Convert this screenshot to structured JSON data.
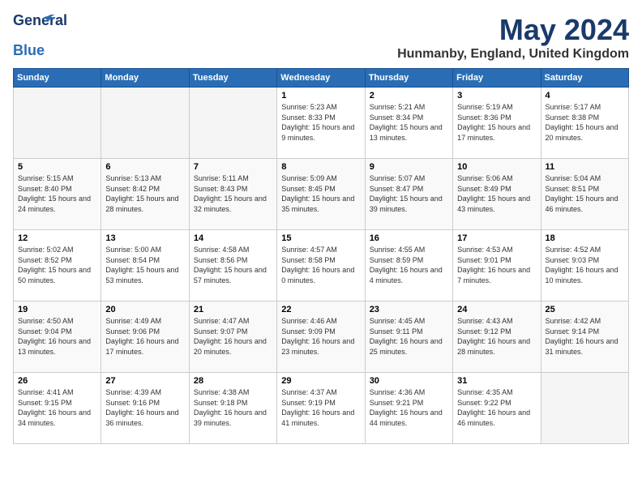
{
  "header": {
    "logo_line1": "General",
    "logo_line2": "Blue",
    "month": "May 2024",
    "location": "Hunmanby, England, United Kingdom"
  },
  "weekdays": [
    "Sunday",
    "Monday",
    "Tuesday",
    "Wednesday",
    "Thursday",
    "Friday",
    "Saturday"
  ],
  "weeks": [
    [
      {
        "day": "",
        "empty": true
      },
      {
        "day": "",
        "empty": true
      },
      {
        "day": "",
        "empty": true
      },
      {
        "day": "1",
        "sunrise": "5:23 AM",
        "sunset": "8:33 PM",
        "daylight": "15 hours and 9 minutes."
      },
      {
        "day": "2",
        "sunrise": "5:21 AM",
        "sunset": "8:34 PM",
        "daylight": "15 hours and 13 minutes."
      },
      {
        "day": "3",
        "sunrise": "5:19 AM",
        "sunset": "8:36 PM",
        "daylight": "15 hours and 17 minutes."
      },
      {
        "day": "4",
        "sunrise": "5:17 AM",
        "sunset": "8:38 PM",
        "daylight": "15 hours and 20 minutes."
      }
    ],
    [
      {
        "day": "5",
        "sunrise": "5:15 AM",
        "sunset": "8:40 PM",
        "daylight": "15 hours and 24 minutes."
      },
      {
        "day": "6",
        "sunrise": "5:13 AM",
        "sunset": "8:42 PM",
        "daylight": "15 hours and 28 minutes."
      },
      {
        "day": "7",
        "sunrise": "5:11 AM",
        "sunset": "8:43 PM",
        "daylight": "15 hours and 32 minutes."
      },
      {
        "day": "8",
        "sunrise": "5:09 AM",
        "sunset": "8:45 PM",
        "daylight": "15 hours and 35 minutes."
      },
      {
        "day": "9",
        "sunrise": "5:07 AM",
        "sunset": "8:47 PM",
        "daylight": "15 hours and 39 minutes."
      },
      {
        "day": "10",
        "sunrise": "5:06 AM",
        "sunset": "8:49 PM",
        "daylight": "15 hours and 43 minutes."
      },
      {
        "day": "11",
        "sunrise": "5:04 AM",
        "sunset": "8:51 PM",
        "daylight": "15 hours and 46 minutes."
      }
    ],
    [
      {
        "day": "12",
        "sunrise": "5:02 AM",
        "sunset": "8:52 PM",
        "daylight": "15 hours and 50 minutes."
      },
      {
        "day": "13",
        "sunrise": "5:00 AM",
        "sunset": "8:54 PM",
        "daylight": "15 hours and 53 minutes."
      },
      {
        "day": "14",
        "sunrise": "4:58 AM",
        "sunset": "8:56 PM",
        "daylight": "15 hours and 57 minutes."
      },
      {
        "day": "15",
        "sunrise": "4:57 AM",
        "sunset": "8:58 PM",
        "daylight": "16 hours and 0 minutes."
      },
      {
        "day": "16",
        "sunrise": "4:55 AM",
        "sunset": "8:59 PM",
        "daylight": "16 hours and 4 minutes."
      },
      {
        "day": "17",
        "sunrise": "4:53 AM",
        "sunset": "9:01 PM",
        "daylight": "16 hours and 7 minutes."
      },
      {
        "day": "18",
        "sunrise": "4:52 AM",
        "sunset": "9:03 PM",
        "daylight": "16 hours and 10 minutes."
      }
    ],
    [
      {
        "day": "19",
        "sunrise": "4:50 AM",
        "sunset": "9:04 PM",
        "daylight": "16 hours and 13 minutes."
      },
      {
        "day": "20",
        "sunrise": "4:49 AM",
        "sunset": "9:06 PM",
        "daylight": "16 hours and 17 minutes."
      },
      {
        "day": "21",
        "sunrise": "4:47 AM",
        "sunset": "9:07 PM",
        "daylight": "16 hours and 20 minutes."
      },
      {
        "day": "22",
        "sunrise": "4:46 AM",
        "sunset": "9:09 PM",
        "daylight": "16 hours and 23 minutes."
      },
      {
        "day": "23",
        "sunrise": "4:45 AM",
        "sunset": "9:11 PM",
        "daylight": "16 hours and 25 minutes."
      },
      {
        "day": "24",
        "sunrise": "4:43 AM",
        "sunset": "9:12 PM",
        "daylight": "16 hours and 28 minutes."
      },
      {
        "day": "25",
        "sunrise": "4:42 AM",
        "sunset": "9:14 PM",
        "daylight": "16 hours and 31 minutes."
      }
    ],
    [
      {
        "day": "26",
        "sunrise": "4:41 AM",
        "sunset": "9:15 PM",
        "daylight": "16 hours and 34 minutes."
      },
      {
        "day": "27",
        "sunrise": "4:39 AM",
        "sunset": "9:16 PM",
        "daylight": "16 hours and 36 minutes."
      },
      {
        "day": "28",
        "sunrise": "4:38 AM",
        "sunset": "9:18 PM",
        "daylight": "16 hours and 39 minutes."
      },
      {
        "day": "29",
        "sunrise": "4:37 AM",
        "sunset": "9:19 PM",
        "daylight": "16 hours and 41 minutes."
      },
      {
        "day": "30",
        "sunrise": "4:36 AM",
        "sunset": "9:21 PM",
        "daylight": "16 hours and 44 minutes."
      },
      {
        "day": "31",
        "sunrise": "4:35 AM",
        "sunset": "9:22 PM",
        "daylight": "16 hours and 46 minutes."
      },
      {
        "day": "",
        "empty": true
      }
    ]
  ]
}
